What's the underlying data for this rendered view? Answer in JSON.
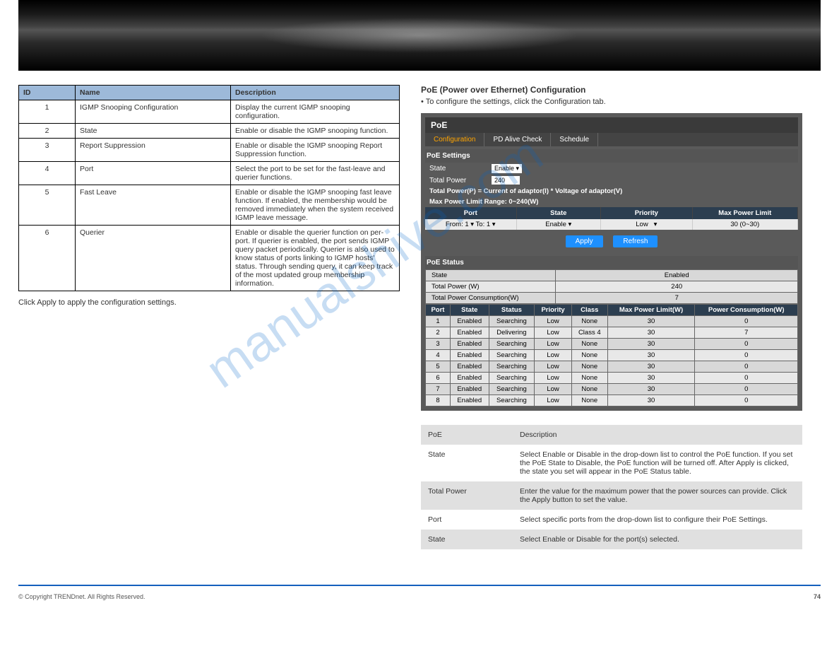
{
  "config_table": {
    "headers": [
      "ID",
      "Name",
      "Description"
    ],
    "rows": [
      {
        "id": "1",
        "name": "IGMP Snooping Configuration",
        "desc": "Display the current IGMP snooping configuration."
      },
      {
        "id": "2",
        "name": "State",
        "desc": "Enable or disable the IGMP snooping function."
      },
      {
        "id": "3",
        "name": "Report Suppression",
        "desc": "Enable or disable the IGMP snooping Report Suppression function."
      },
      {
        "id": "4",
        "name": "Port",
        "desc": "Select the port to be set for the fast-leave and querier functions."
      },
      {
        "id": "5",
        "name": "Fast Leave",
        "desc": "Enable or disable the IGMP snooping fast leave function. If enabled, the membership would be removed immediately when the system received IGMP leave message."
      },
      {
        "id": "6",
        "name": "Querier",
        "desc": "Enable or disable the querier function on per-port. If querier is enabled, the port sends IGMP query packet periodically. Querier is also used to know status of ports linking to IGMP hosts' status. Through sending query, it can keep track of the most updated group membership information."
      }
    ]
  },
  "left": {
    "note": "Click Apply to apply the configuration settings."
  },
  "right_section": {
    "title": "PoE (Power over Ethernet) Configuration",
    "desc": "• To configure the settings, click the Configuration tab."
  },
  "panel": {
    "title": "PoE",
    "tabs": [
      "Configuration",
      "PD Alive Check",
      "Schedule"
    ],
    "sec1": "PoE Settings",
    "state_lbl": "State",
    "state_val": "Enable",
    "tp_lbl": "Total Power",
    "tp_val": "240",
    "formula1": "Total Power(P) = Current of adaptor(I) * Voltage of adaptor(V)",
    "formula2": "Max Power Limit Range: 0~240(W)",
    "hdr": {
      "port": "Port",
      "state": "State",
      "prio": "Priority",
      "max": "Max Power Limit"
    },
    "form": {
      "from": "From:",
      "to": "To:",
      "from_v": "1",
      "to_v": "1",
      "state": "Enable",
      "prio": "Low",
      "max": "30",
      "range": "(0~30)"
    },
    "btn1": "Apply",
    "btn2": "Refresh",
    "sec2": "PoE Status",
    "stat_rows": [
      {
        "k": "State",
        "v": "Enabled"
      },
      {
        "k": "Total Power (W)",
        "v": "240"
      },
      {
        "k": "Total Power Consumption(W)",
        "v": "7"
      }
    ]
  },
  "chart_data": {
    "type": "table",
    "title": "PoE Port Status",
    "columns": [
      "Port",
      "State",
      "Status",
      "Priority",
      "Class",
      "Max Power Limit(W)",
      "Power Consumption(W)"
    ],
    "rows": [
      [
        "1",
        "Enabled",
        "Searching",
        "Low",
        "None",
        "30",
        "0"
      ],
      [
        "2",
        "Enabled",
        "Delivering",
        "Low",
        "Class 4",
        "30",
        "7"
      ],
      [
        "3",
        "Enabled",
        "Searching",
        "Low",
        "None",
        "30",
        "0"
      ],
      [
        "4",
        "Enabled",
        "Searching",
        "Low",
        "None",
        "30",
        "0"
      ],
      [
        "5",
        "Enabled",
        "Searching",
        "Low",
        "None",
        "30",
        "0"
      ],
      [
        "6",
        "Enabled",
        "Searching",
        "Low",
        "None",
        "30",
        "0"
      ],
      [
        "7",
        "Enabled",
        "Searching",
        "Low",
        "None",
        "30",
        "0"
      ],
      [
        "8",
        "Enabled",
        "Searching",
        "Low",
        "None",
        "30",
        "0"
      ]
    ]
  },
  "info_table": {
    "headers": [
      "PoE",
      "Description"
    ],
    "rows": [
      {
        "k": "State",
        "v": "Select Enable or Disable in the drop-down list to control the PoE function. If you set the PoE State to Disable, the PoE function will be turned off. After Apply is clicked, the state you set will appear in the PoE Status table."
      },
      {
        "k": "Total Power",
        "v": "Enter the value for the maximum power that the power sources can provide. Click the Apply button to set the value."
      },
      {
        "k": "Port",
        "v": "Select specific ports from the drop-down list to configure their PoE Settings."
      },
      {
        "k": "State",
        "v": "Select Enable or Disable for the port(s) selected."
      }
    ]
  },
  "footer": {
    "copy": "© Copyright TRENDnet. All Rights Reserved.",
    "page": "74"
  },
  "watermark": "manualshive.com"
}
